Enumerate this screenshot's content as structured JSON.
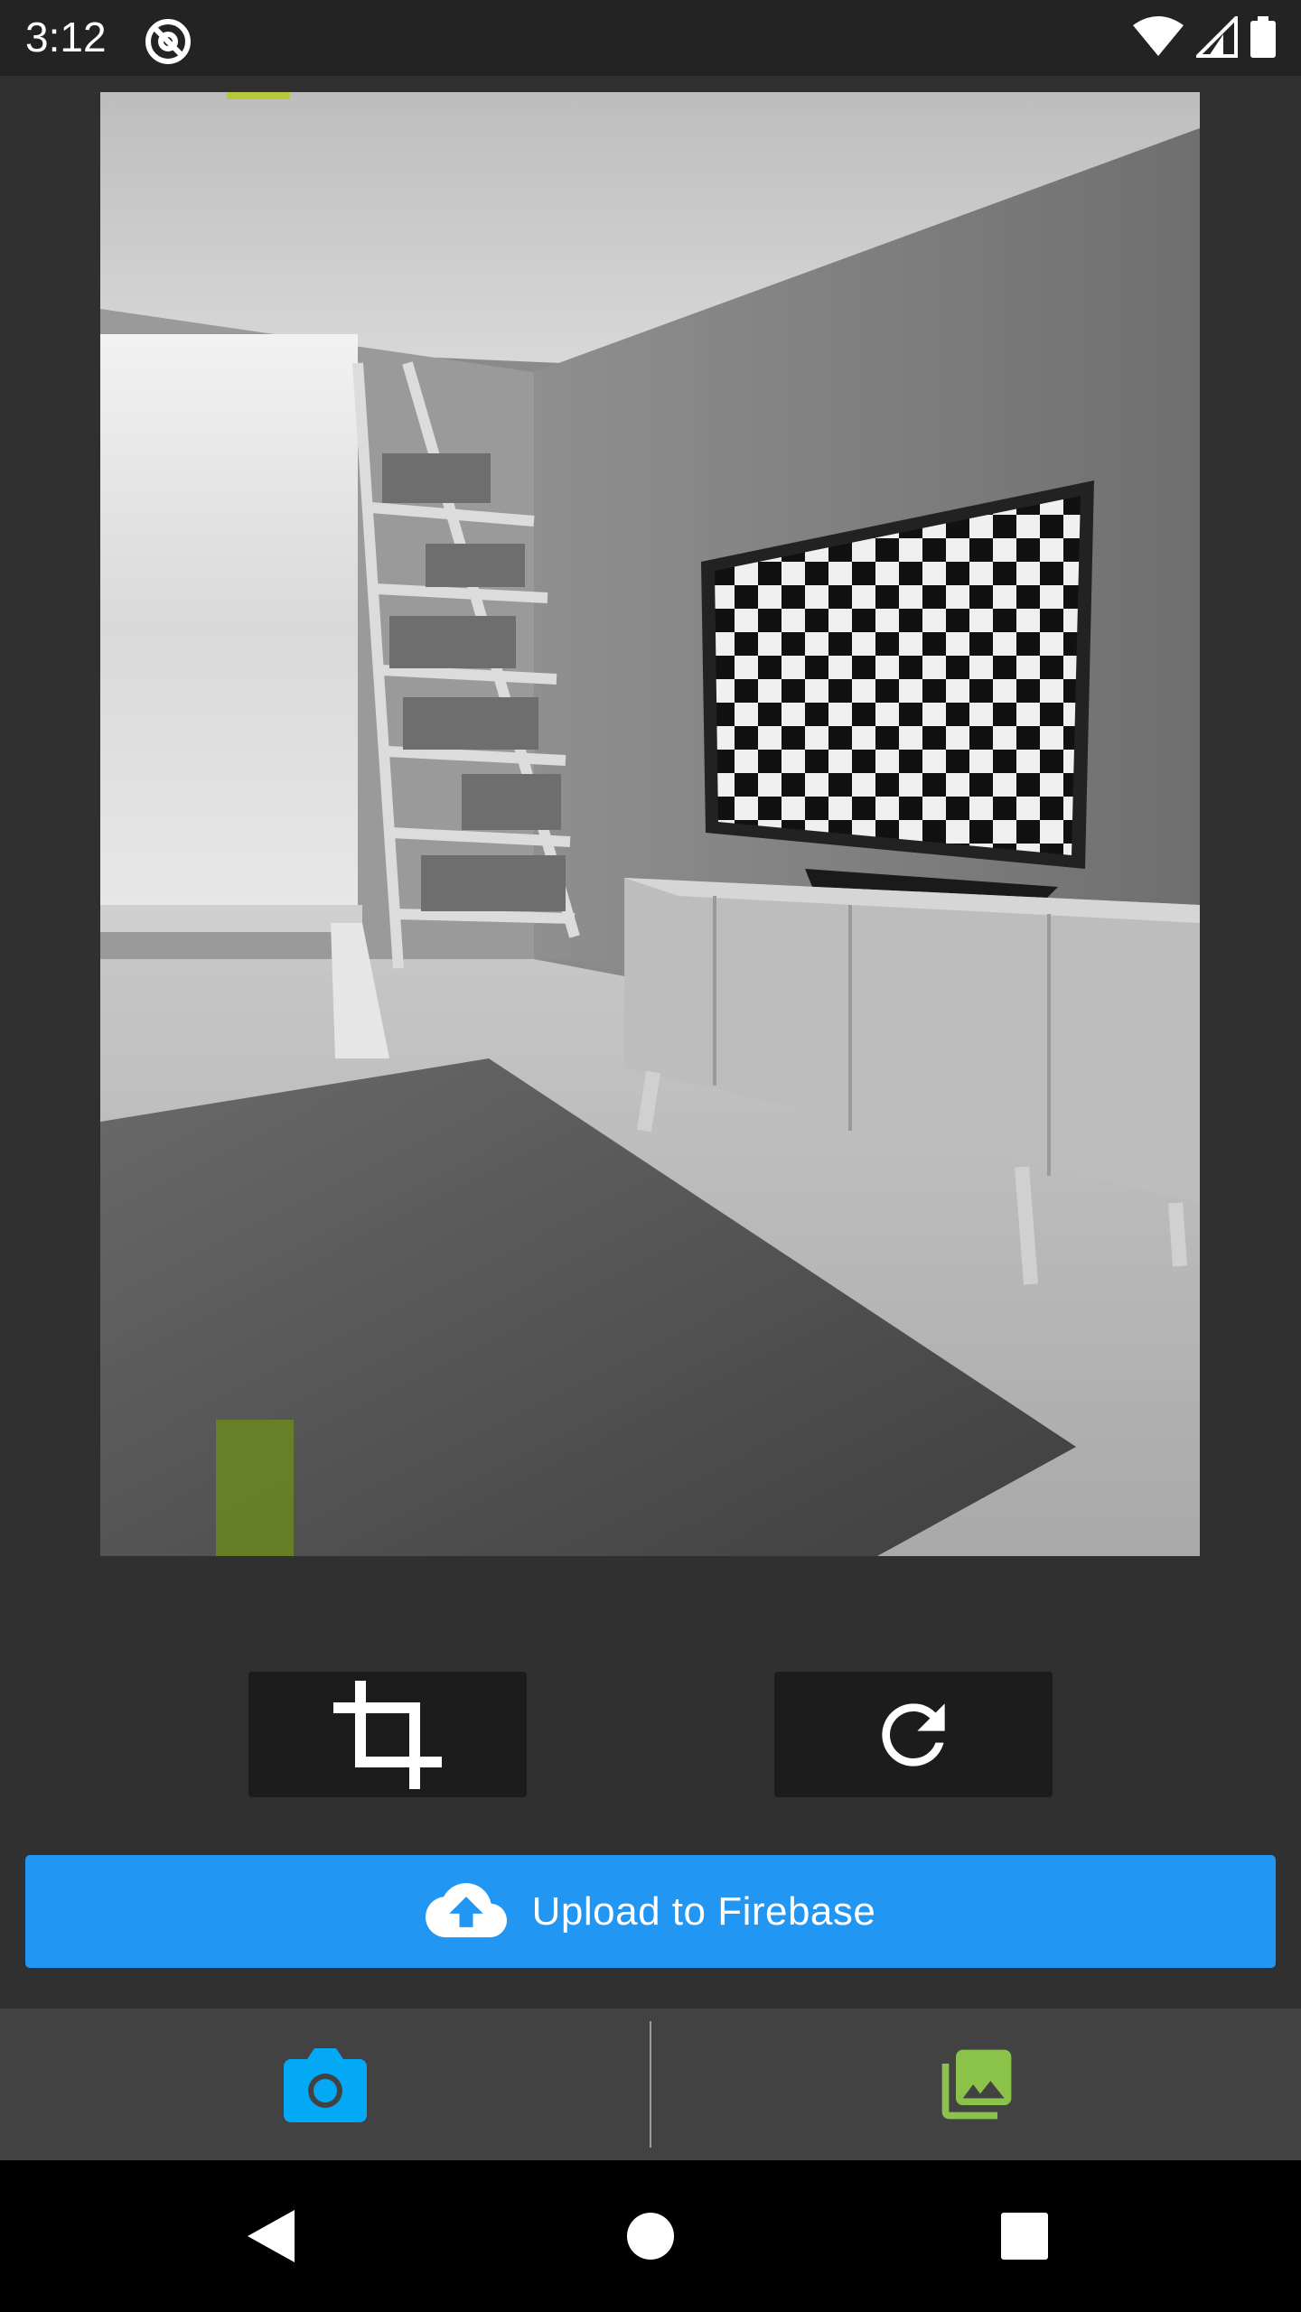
{
  "status_bar": {
    "time": "3:12",
    "icons": [
      "app-notification-icon",
      "wifi-icon",
      "cell-signal-icon",
      "battery-icon"
    ]
  },
  "photo": {
    "description_icon": "image-preview"
  },
  "toolbar": {
    "crop_icon": "crop-icon",
    "rotate_icon": "rotate-icon"
  },
  "upload": {
    "label": "Upload to Firebase",
    "icon": "cloud-upload-icon",
    "color": "#2196f3"
  },
  "bottom_bar": {
    "camera_icon": "camera-icon",
    "camera_color": "#03a9f4",
    "gallery_icon": "photo-library-icon",
    "gallery_color": "#8bc34a"
  },
  "nav_bar": {
    "icons": [
      "back-icon",
      "home-icon",
      "recents-icon"
    ]
  }
}
